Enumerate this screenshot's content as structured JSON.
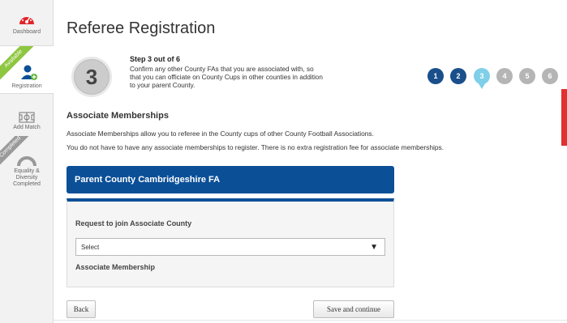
{
  "sidebar": {
    "items": [
      {
        "label": "Dashboard",
        "icon": "speedometer-icon"
      },
      {
        "label": "Registration",
        "icon": "add-user-icon",
        "ribbon": "Available"
      },
      {
        "label": "Add Match",
        "icon": "pitch-icon"
      },
      {
        "label_line1": "Equality &",
        "label_line2": "Diversity",
        "label_line3": "Completed",
        "icon": "gauge-icon",
        "ribbon": "Completed"
      }
    ]
  },
  "page": {
    "title": "Referee Registration"
  },
  "step": {
    "number": "3",
    "heading": "Step 3 out of 6",
    "description": "Confirm any other County FAs that you are associated with, so that you can officiate on County Cups in other counties in addition to your parent County."
  },
  "progress": {
    "steps": [
      "1",
      "2",
      "3",
      "4",
      "5",
      "6"
    ],
    "current": 3,
    "colors": {
      "done": "#1b4f8c",
      "current": "#7fcfe8",
      "todo": "#b5b5b5"
    }
  },
  "section": {
    "title": "Associate Memberships",
    "para1": "Associate Memberships allow you to referee in the County cups of other County Football Associations.",
    "para2": "You do not have to have any associate memberships to register. There is no extra registration fee for associate memberships."
  },
  "parent_county": {
    "label": "Parent County Cambridgeshire FA",
    "color": "#0b4f97"
  },
  "form": {
    "request_label": "Request to join Associate County",
    "select_value": "Select",
    "membership_label": "Associate Membership"
  },
  "buttons": {
    "back": "Back",
    "save": "Save and continue"
  }
}
